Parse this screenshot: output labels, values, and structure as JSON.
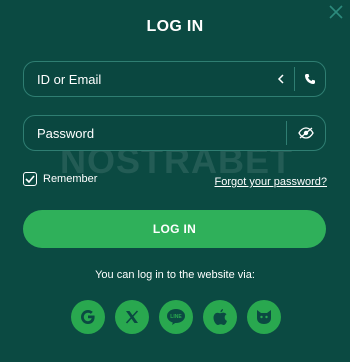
{
  "dialog": {
    "title": "LOG IN",
    "close_icon": "close-icon"
  },
  "watermark": "NOSTRABET",
  "id_field": {
    "placeholder": "ID or Email",
    "switch_icon": "chevron-left-icon",
    "phone_icon": "phone-icon"
  },
  "password_field": {
    "placeholder": "Password",
    "toggle_icon": "eye-off-icon"
  },
  "remember": {
    "label": "Remember",
    "checked": true
  },
  "forgot_label": "Forgot your password?",
  "login_button": "LOG IN",
  "social": {
    "caption": "You can log in to the website via:",
    "providers": [
      "google",
      "x",
      "line",
      "apple",
      "steam"
    ]
  },
  "colors": {
    "background": "#0b4a42",
    "accent": "#2fb05a",
    "border": "#2f7e72"
  }
}
